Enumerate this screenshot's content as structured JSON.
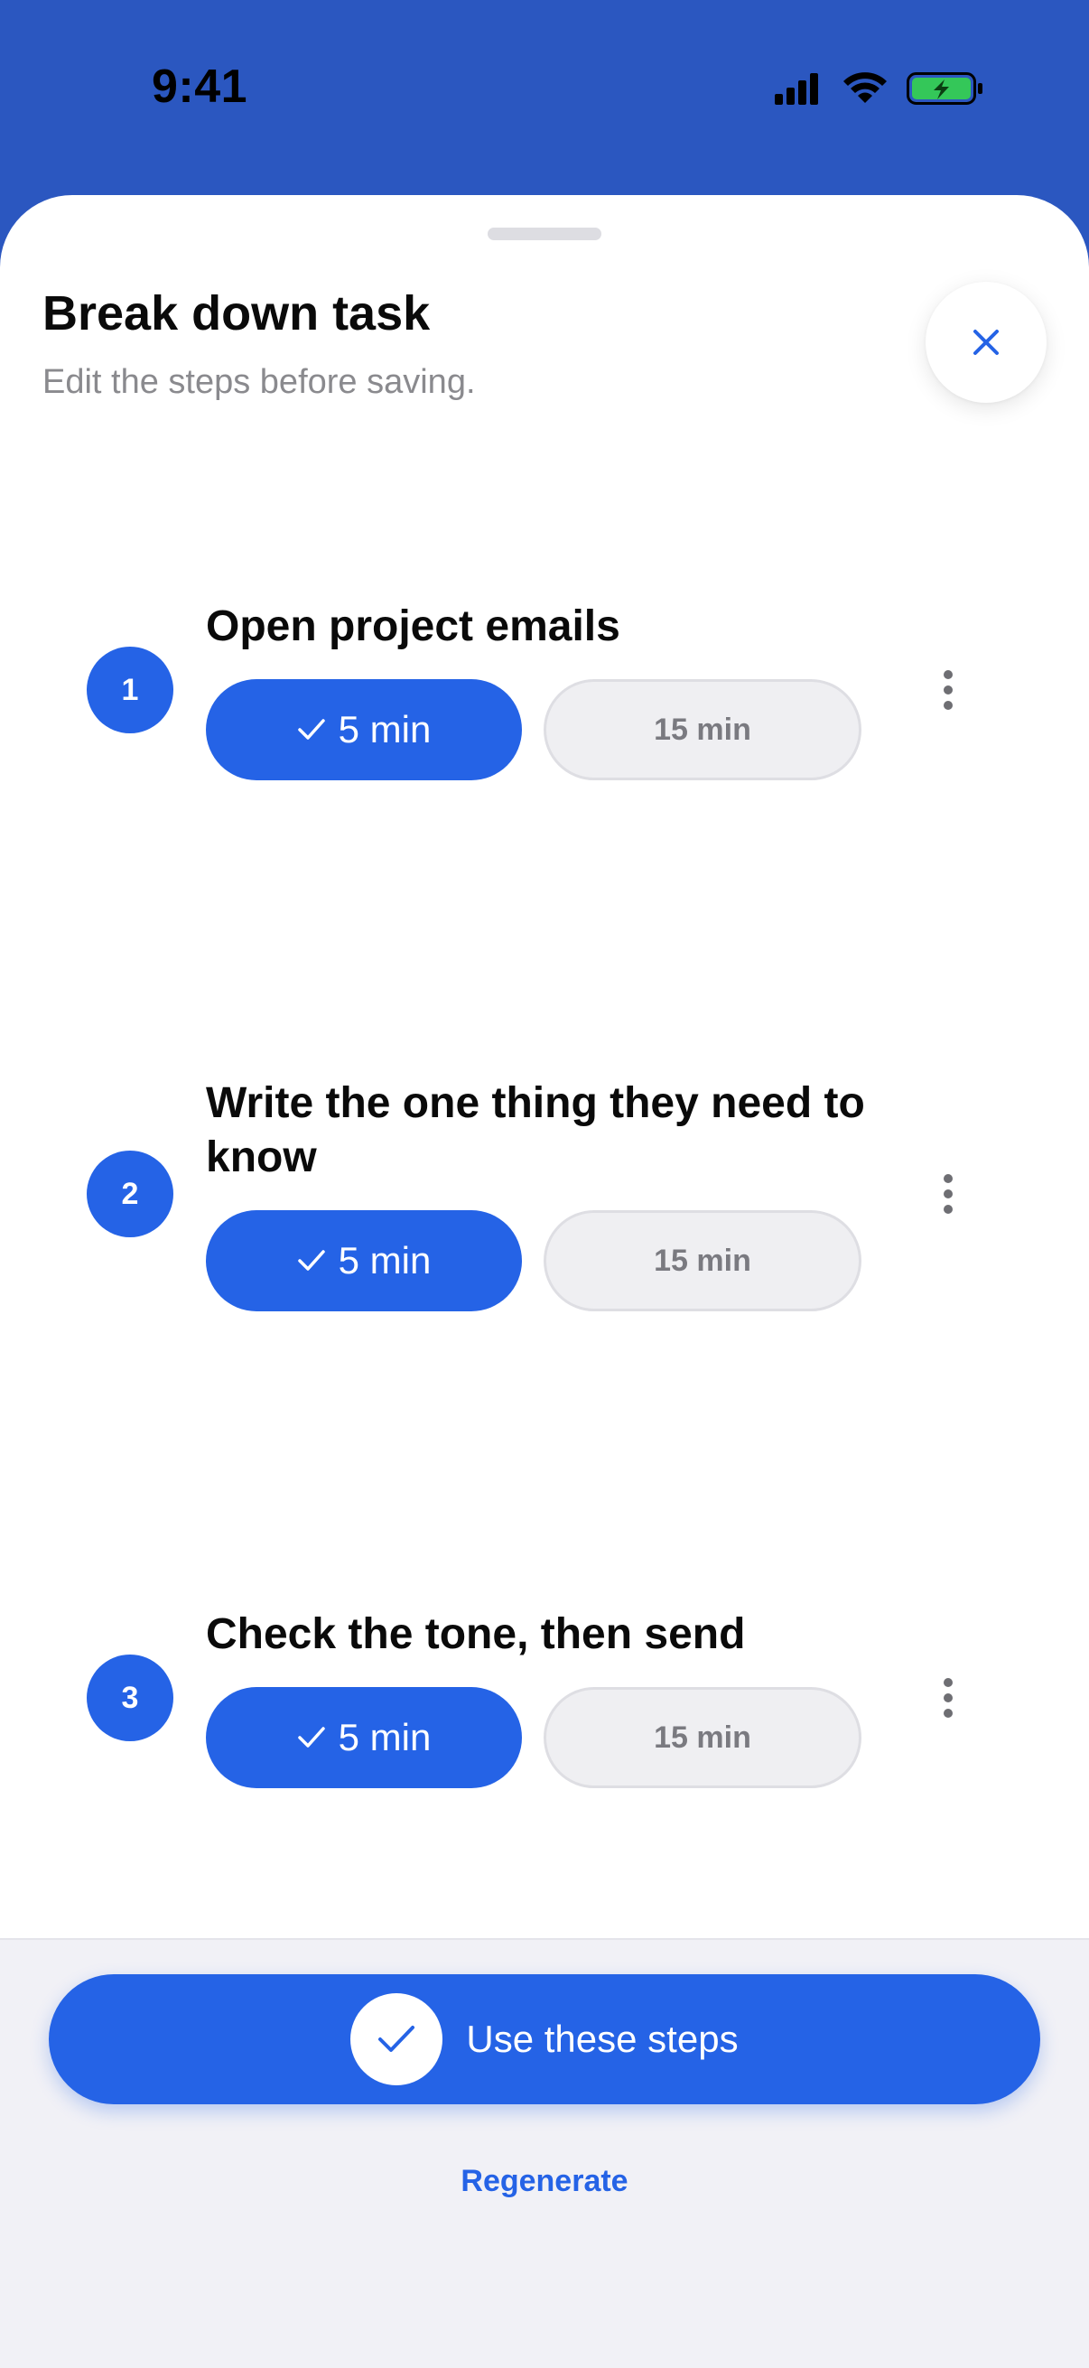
{
  "status_bar": {
    "time": "9:41",
    "icons": [
      "signal-icon",
      "wifi-icon",
      "battery-charging-icon"
    ]
  },
  "sheet": {
    "title": "Break down task",
    "subtitle": "Edit the steps before saving.",
    "close_icon": "close-icon"
  },
  "steps": [
    {
      "number": "1",
      "title": "Open project emails",
      "selected_duration": "5 min",
      "other_duration": "15 min"
    },
    {
      "number": "2",
      "title": "Write the one thing they need to know",
      "selected_duration": "5 min",
      "other_duration": "15 min"
    },
    {
      "number": "3",
      "title": "Check the tone, then send",
      "selected_duration": "5 min",
      "other_duration": "15 min"
    }
  ],
  "footer": {
    "primary_label": "Use these steps",
    "secondary_label": "Regenerate"
  },
  "colors": {
    "accent": "#2563E6",
    "header_background": "#2B57C0",
    "sheet_background": "#FFFFFF",
    "footer_background": "#F1F1F6",
    "inactive_pill": "#EFEFF2",
    "battery": "#34C759"
  }
}
